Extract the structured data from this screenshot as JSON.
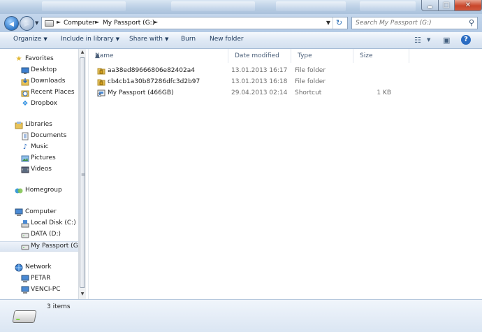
{
  "window": {
    "minimize_glyph": "▬",
    "maximize_glyph": "□",
    "close_glyph": "✕"
  },
  "navigation": {
    "back_glyph": "◀",
    "forward_glyph": "▶",
    "history_glyph": "▼"
  },
  "address": {
    "breadcrumbs": [
      "Computer",
      "My Passport (G:)"
    ],
    "separator": "►",
    "dropdown_glyph": "▼",
    "refresh_glyph": "↻"
  },
  "search": {
    "placeholder": "Search My Passport (G:)",
    "icon": "search-icon"
  },
  "toolbar": {
    "organize": "Organize",
    "include_in_library": "Include in library",
    "share_with": "Share with",
    "burn": "Burn",
    "new_folder": "New folder",
    "caret": "▼",
    "help": "?"
  },
  "sidebar": {
    "items": [
      {
        "label": "Favorites",
        "icon": "star-icon",
        "level": 0
      },
      {
        "label": "Desktop",
        "icon": "desktop-icon",
        "level": 1
      },
      {
        "label": "Downloads",
        "icon": "downloads-icon",
        "level": 1
      },
      {
        "label": "Recent Places",
        "icon": "recent-places-icon",
        "level": 1
      },
      {
        "label": "Dropbox",
        "icon": "dropbox-icon",
        "level": 1
      },
      {
        "label": "Libraries",
        "icon": "libraries-icon",
        "level": 0
      },
      {
        "label": "Documents",
        "icon": "documents-icon",
        "level": 1
      },
      {
        "label": "Music",
        "icon": "music-icon",
        "level": 1
      },
      {
        "label": "Pictures",
        "icon": "pictures-icon",
        "level": 1
      },
      {
        "label": "Videos",
        "icon": "videos-icon",
        "level": 1
      },
      {
        "label": "Homegroup",
        "icon": "homegroup-icon",
        "level": 0
      },
      {
        "label": "Computer",
        "icon": "computer-icon",
        "level": 0
      },
      {
        "label": "Local Disk (C:)",
        "icon": "local-disk-icon",
        "level": 1
      },
      {
        "label": "DATA (D:)",
        "icon": "drive-icon",
        "level": 1
      },
      {
        "label": "My Passport (G:)",
        "icon": "drive-icon",
        "level": 1,
        "selected": true
      },
      {
        "label": "Network",
        "icon": "network-icon",
        "level": 0
      },
      {
        "label": "PETAR",
        "icon": "network-pc-icon",
        "level": 1
      },
      {
        "label": "VENCI-PC",
        "icon": "network-pc-icon",
        "level": 1
      }
    ]
  },
  "columns": {
    "name": "Name",
    "date_modified": "Date modified",
    "type": "Type",
    "size": "Size",
    "sort_glyph": "▲"
  },
  "files": [
    {
      "name": "aa38ed89666806e82402a4",
      "date": "13.01.2013 16:17",
      "type": "File folder",
      "size": "",
      "icon": "locked-folder-icon"
    },
    {
      "name": "cb4cb1a30b87286dfc3d2b97",
      "date": "13.01.2013 16:18",
      "type": "File folder",
      "size": "",
      "icon": "locked-folder-icon"
    },
    {
      "name": "My Passport (466GB)",
      "date": "29.04.2013 02:14",
      "type": "Shortcut",
      "size": "1 KB",
      "icon": "shortcut-icon"
    }
  ],
  "status": {
    "item_count": "3 items"
  },
  "colors": {
    "accent": "#2a6cc2",
    "folder": "#e8c35a",
    "glass": "#b8cde4"
  }
}
